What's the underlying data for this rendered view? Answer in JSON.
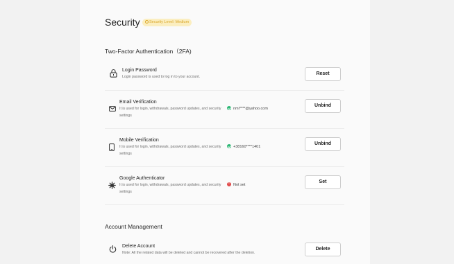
{
  "header": {
    "title": "Security",
    "security_level": "Security Level: Medium"
  },
  "two_factor": {
    "heading": "Two-Factor Authentication（2FA)",
    "items": [
      {
        "icon": "lock-icon",
        "name": "Login Password",
        "description": "Login password is used to log in to your account.",
        "status": "",
        "status_color": "",
        "button": "Reset"
      },
      {
        "icon": "mail-icon",
        "name": "Email Verification",
        "description": "It is used for login, withdrawals, password updates, and security settings",
        "status": "nmi****@yahoo.com",
        "status_color": "#2bb673",
        "button": "Unbind"
      },
      {
        "icon": "phone-icon",
        "name": "Mobile Verification",
        "description": "It is used for login, withdrawals, password updates, and security settings",
        "status": "+38160****1401",
        "status_color": "#2bb673",
        "button": "Unbind"
      },
      {
        "icon": "authenticator-icon",
        "name": "Google Authenticator",
        "description": "It is used for login, withdrawals, password updates, and security settings",
        "status": "Not set",
        "status_color": "#e04848",
        "button": "Set"
      }
    ]
  },
  "account_management": {
    "heading": "Account Management",
    "delete": {
      "icon": "power-icon",
      "name": "Delete Account",
      "description": "Note: All the related data will be deleted and cannot be recovered after the deletion.",
      "button": "Delete"
    }
  }
}
